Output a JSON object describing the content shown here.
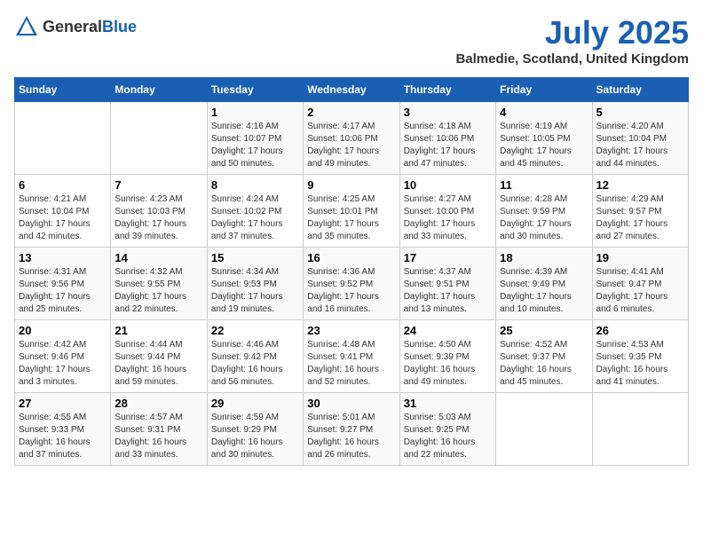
{
  "header": {
    "logo_general": "General",
    "logo_blue": "Blue",
    "title": "July 2025",
    "subtitle": "Balmedie, Scotland, United Kingdom"
  },
  "calendar": {
    "days_of_week": [
      "Sunday",
      "Monday",
      "Tuesday",
      "Wednesday",
      "Thursday",
      "Friday",
      "Saturday"
    ],
    "weeks": [
      [
        {
          "day": "",
          "info": ""
        },
        {
          "day": "",
          "info": ""
        },
        {
          "day": "1",
          "info": "Sunrise: 4:16 AM\nSunset: 10:07 PM\nDaylight: 17 hours and 50 minutes."
        },
        {
          "day": "2",
          "info": "Sunrise: 4:17 AM\nSunset: 10:06 PM\nDaylight: 17 hours and 49 minutes."
        },
        {
          "day": "3",
          "info": "Sunrise: 4:18 AM\nSunset: 10:06 PM\nDaylight: 17 hours and 47 minutes."
        },
        {
          "day": "4",
          "info": "Sunrise: 4:19 AM\nSunset: 10:05 PM\nDaylight: 17 hours and 45 minutes."
        },
        {
          "day": "5",
          "info": "Sunrise: 4:20 AM\nSunset: 10:04 PM\nDaylight: 17 hours and 44 minutes."
        }
      ],
      [
        {
          "day": "6",
          "info": "Sunrise: 4:21 AM\nSunset: 10:04 PM\nDaylight: 17 hours and 42 minutes."
        },
        {
          "day": "7",
          "info": "Sunrise: 4:23 AM\nSunset: 10:03 PM\nDaylight: 17 hours and 39 minutes."
        },
        {
          "day": "8",
          "info": "Sunrise: 4:24 AM\nSunset: 10:02 PM\nDaylight: 17 hours and 37 minutes."
        },
        {
          "day": "9",
          "info": "Sunrise: 4:25 AM\nSunset: 10:01 PM\nDaylight: 17 hours and 35 minutes."
        },
        {
          "day": "10",
          "info": "Sunrise: 4:27 AM\nSunset: 10:00 PM\nDaylight: 17 hours and 33 minutes."
        },
        {
          "day": "11",
          "info": "Sunrise: 4:28 AM\nSunset: 9:59 PM\nDaylight: 17 hours and 30 minutes."
        },
        {
          "day": "12",
          "info": "Sunrise: 4:29 AM\nSunset: 9:57 PM\nDaylight: 17 hours and 27 minutes."
        }
      ],
      [
        {
          "day": "13",
          "info": "Sunrise: 4:31 AM\nSunset: 9:56 PM\nDaylight: 17 hours and 25 minutes."
        },
        {
          "day": "14",
          "info": "Sunrise: 4:32 AM\nSunset: 9:55 PM\nDaylight: 17 hours and 22 minutes."
        },
        {
          "day": "15",
          "info": "Sunrise: 4:34 AM\nSunset: 9:53 PM\nDaylight: 17 hours and 19 minutes."
        },
        {
          "day": "16",
          "info": "Sunrise: 4:36 AM\nSunset: 9:52 PM\nDaylight: 17 hours and 16 minutes."
        },
        {
          "day": "17",
          "info": "Sunrise: 4:37 AM\nSunset: 9:51 PM\nDaylight: 17 hours and 13 minutes."
        },
        {
          "day": "18",
          "info": "Sunrise: 4:39 AM\nSunset: 9:49 PM\nDaylight: 17 hours and 10 minutes."
        },
        {
          "day": "19",
          "info": "Sunrise: 4:41 AM\nSunset: 9:47 PM\nDaylight: 17 hours and 6 minutes."
        }
      ],
      [
        {
          "day": "20",
          "info": "Sunrise: 4:42 AM\nSunset: 9:46 PM\nDaylight: 17 hours and 3 minutes."
        },
        {
          "day": "21",
          "info": "Sunrise: 4:44 AM\nSunset: 9:44 PM\nDaylight: 16 hours and 59 minutes."
        },
        {
          "day": "22",
          "info": "Sunrise: 4:46 AM\nSunset: 9:42 PM\nDaylight: 16 hours and 56 minutes."
        },
        {
          "day": "23",
          "info": "Sunrise: 4:48 AM\nSunset: 9:41 PM\nDaylight: 16 hours and 52 minutes."
        },
        {
          "day": "24",
          "info": "Sunrise: 4:50 AM\nSunset: 9:39 PM\nDaylight: 16 hours and 49 minutes."
        },
        {
          "day": "25",
          "info": "Sunrise: 4:52 AM\nSunset: 9:37 PM\nDaylight: 16 hours and 45 minutes."
        },
        {
          "day": "26",
          "info": "Sunrise: 4:53 AM\nSunset: 9:35 PM\nDaylight: 16 hours and 41 minutes."
        }
      ],
      [
        {
          "day": "27",
          "info": "Sunrise: 4:55 AM\nSunset: 9:33 PM\nDaylight: 16 hours and 37 minutes."
        },
        {
          "day": "28",
          "info": "Sunrise: 4:57 AM\nSunset: 9:31 PM\nDaylight: 16 hours and 33 minutes."
        },
        {
          "day": "29",
          "info": "Sunrise: 4:59 AM\nSunset: 9:29 PM\nDaylight: 16 hours and 30 minutes."
        },
        {
          "day": "30",
          "info": "Sunrise: 5:01 AM\nSunset: 9:27 PM\nDaylight: 16 hours and 26 minutes."
        },
        {
          "day": "31",
          "info": "Sunrise: 5:03 AM\nSunset: 9:25 PM\nDaylight: 16 hours and 22 minutes."
        },
        {
          "day": "",
          "info": ""
        },
        {
          "day": "",
          "info": ""
        }
      ]
    ]
  }
}
